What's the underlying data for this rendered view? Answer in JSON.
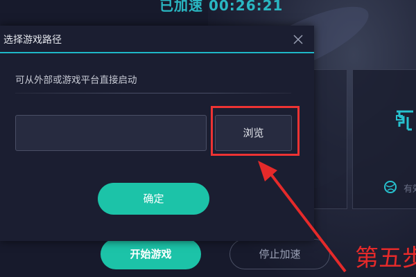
{
  "app": {
    "timer_text": "已加速 00:26:21",
    "start_button_label": "开始游戏",
    "stop_button_label": "停止加速",
    "card_partial_text": "有效"
  },
  "dialog": {
    "title": "选择游戏路径",
    "close_icon": "close-icon",
    "description": "可从外部或游戏平台直接启动",
    "path_input_value": "",
    "path_input_placeholder": "",
    "browse_label": "浏览",
    "confirm_label": "确定"
  },
  "annotation": {
    "step_label": "第五步",
    "color": "#e52a2a"
  },
  "colors": {
    "accent": "#1cc3a8",
    "header_line": "#1fb8c8",
    "background": "#171a2c"
  }
}
